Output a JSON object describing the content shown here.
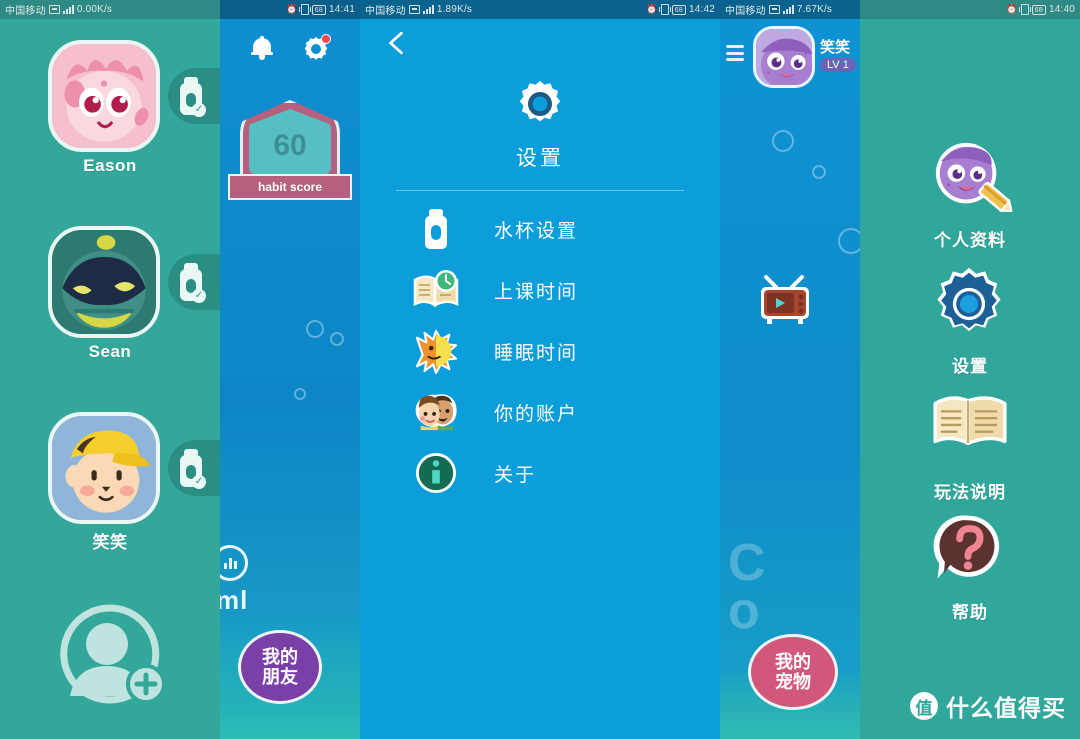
{
  "panels": {
    "friend_list": {
      "statusbar": {
        "carrier": "中国移动",
        "speed": "0.00K/s",
        "time": ""
      },
      "friends": [
        {
          "name": "Eason",
          "avatar": "pink-monster-avatar",
          "badge": "bottle-ok-badge"
        },
        {
          "name": "Sean",
          "avatar": "teal-monster-avatar",
          "badge": "bottle-ok-badge"
        },
        {
          "name": "笑笑",
          "avatar": "boy-yellow-cap-avatar",
          "badge": "bottle-ok-badge"
        }
      ],
      "add_user_icon": "add-user-icon"
    },
    "habit_home": {
      "statusbar": {
        "carrier": "",
        "speed": "",
        "battery": "68",
        "time": "14:41"
      },
      "bell_icon": "bell-icon",
      "gear_icon": "gear-icon",
      "gear_badge": "1",
      "score": {
        "value": "60",
        "caption": "habit score"
      },
      "chart_icon": "stats-chart-icon",
      "cut_text": "ml",
      "bottom_button": "我的朋友"
    },
    "settings": {
      "statusbar": {
        "carrier": "中国移动",
        "speed": "1.89K/s",
        "battery": "68",
        "time": "14:42"
      },
      "back_icon": "back-chevron-icon",
      "header_icon": "gear-icon",
      "title": "设置",
      "items": [
        {
          "label": "水杯设置",
          "icon": "water-bottle-icon"
        },
        {
          "label": "上课时间",
          "icon": "book-clock-icon"
        },
        {
          "label": "睡眠时间",
          "icon": "sun-moon-icon"
        },
        {
          "label": "你的账户",
          "icon": "two-faces-icon"
        },
        {
          "label": "关于",
          "icon": "info-icon"
        }
      ]
    },
    "pet_home": {
      "statusbar": {
        "carrier": "中国移动",
        "speed": "7.67K/s",
        "time": ""
      },
      "menu_icon": "hamburger-menu-icon",
      "pet_avatar": "purple-monster-avatar",
      "pet_name": "笑笑",
      "pet_level": "LV 1",
      "tv_icon": "retro-tv-icon",
      "ghost_text": "C o",
      "bottom_button": "我的宠物"
    },
    "side_menu": {
      "statusbar": {
        "carrier": "",
        "speed": "",
        "battery": "68",
        "time": "14:40"
      },
      "items": [
        {
          "label": "个人资料",
          "icon": "profile-edit-icon"
        },
        {
          "label": "设置",
          "icon": "gear-icon"
        },
        {
          "label": "玩法说明",
          "icon": "open-book-icon"
        },
        {
          "label": "帮助",
          "icon": "question-bubble-icon"
        }
      ],
      "watermark": {
        "logo": "值",
        "text": "什么值得买"
      }
    }
  },
  "colors": {
    "teal": "#34a79b",
    "blue": "#0c9edb",
    "purple_btn": "#7b3fa8",
    "pink_btn": "#d1577b",
    "badge_red": "#f2494c",
    "score_pink": "#b5607e",
    "score_teal": "#57bfc4"
  }
}
